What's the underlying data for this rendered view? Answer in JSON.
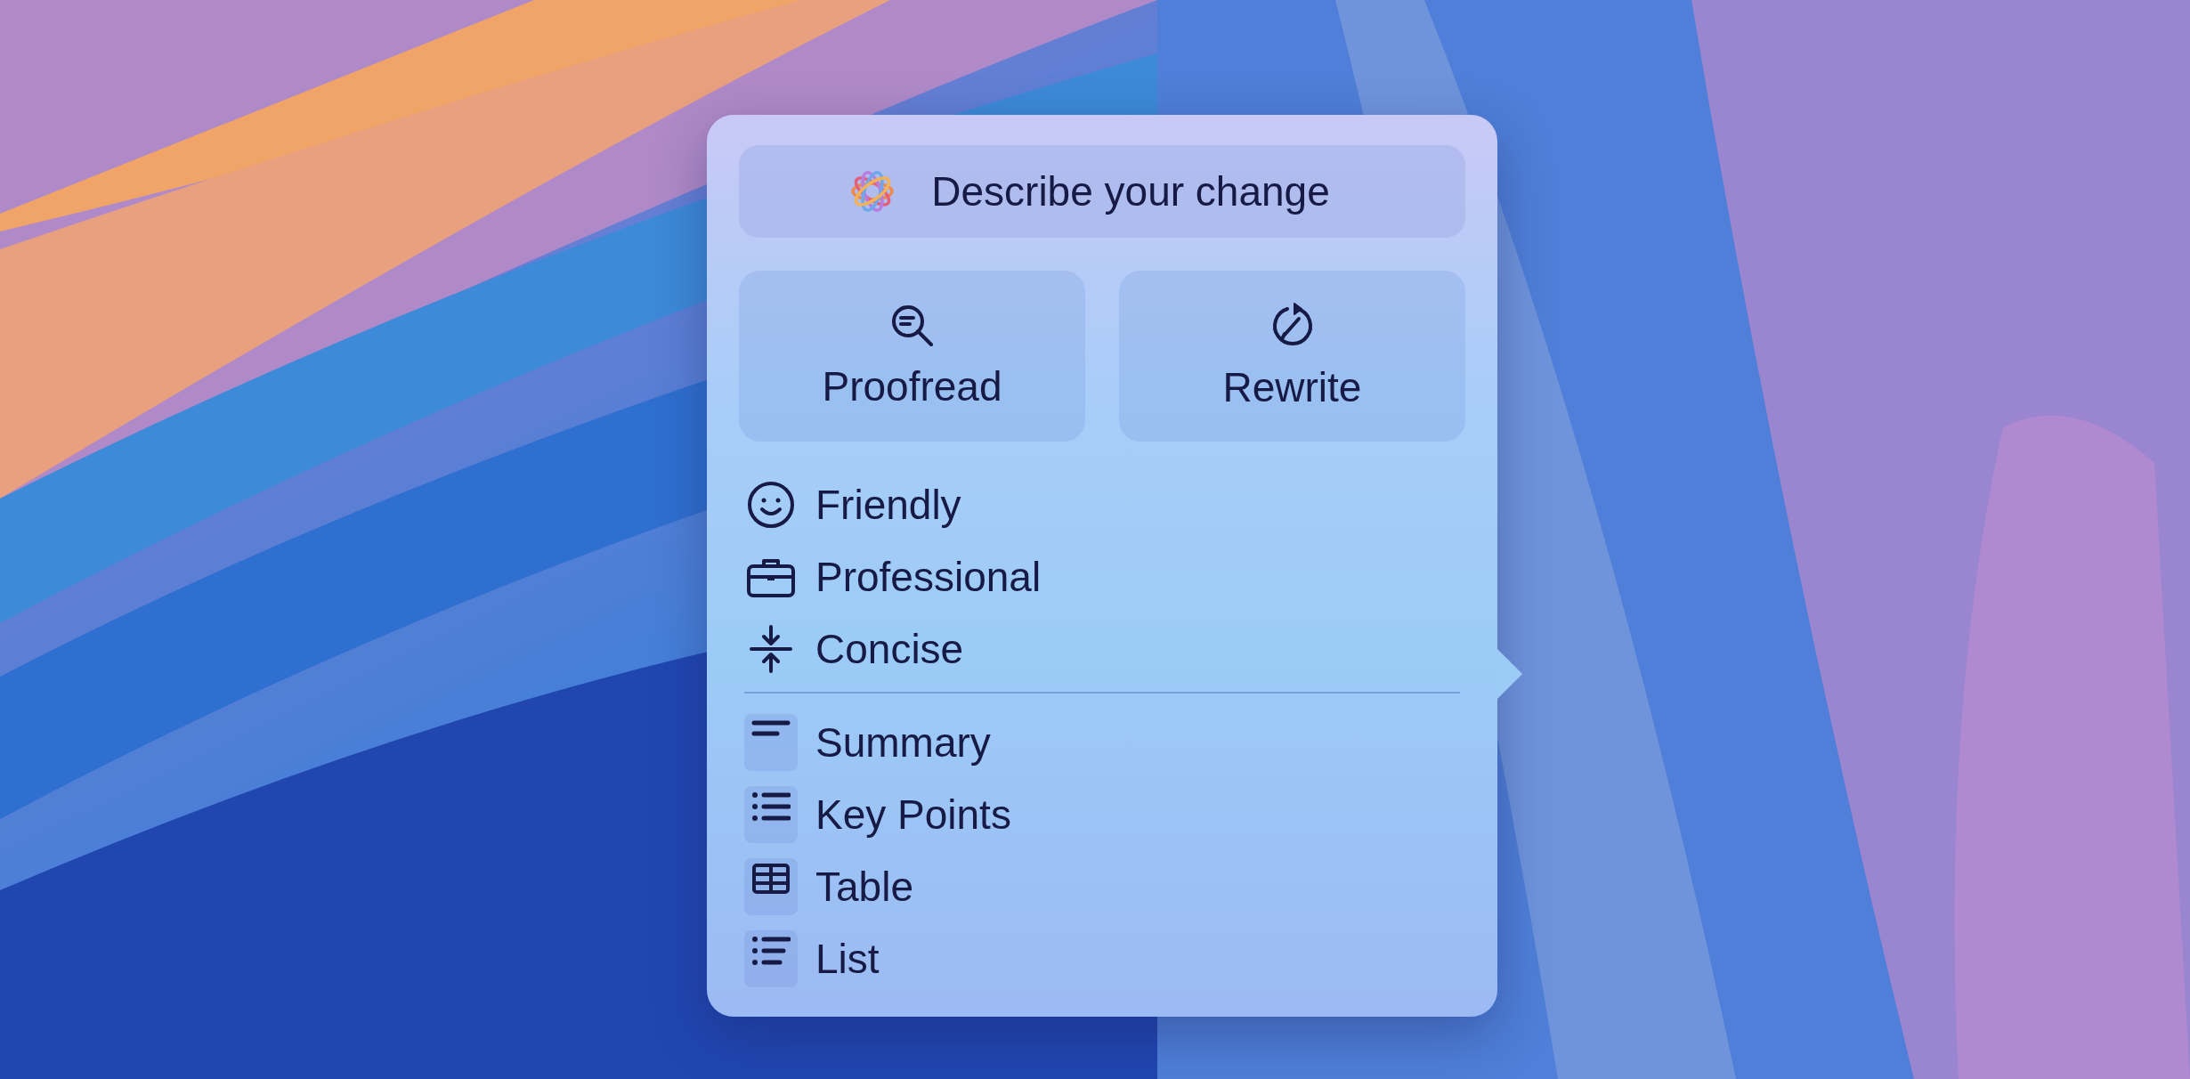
{
  "prompt": {
    "placeholder": "Describe your change"
  },
  "actions": [
    {
      "label": "Proofread"
    },
    {
      "label": "Rewrite"
    }
  ],
  "tones": [
    {
      "label": "Friendly"
    },
    {
      "label": "Professional"
    },
    {
      "label": "Concise"
    }
  ],
  "formats": [
    {
      "label": "Summary"
    },
    {
      "label": "Key Points"
    },
    {
      "label": "Table"
    },
    {
      "label": "List"
    }
  ]
}
